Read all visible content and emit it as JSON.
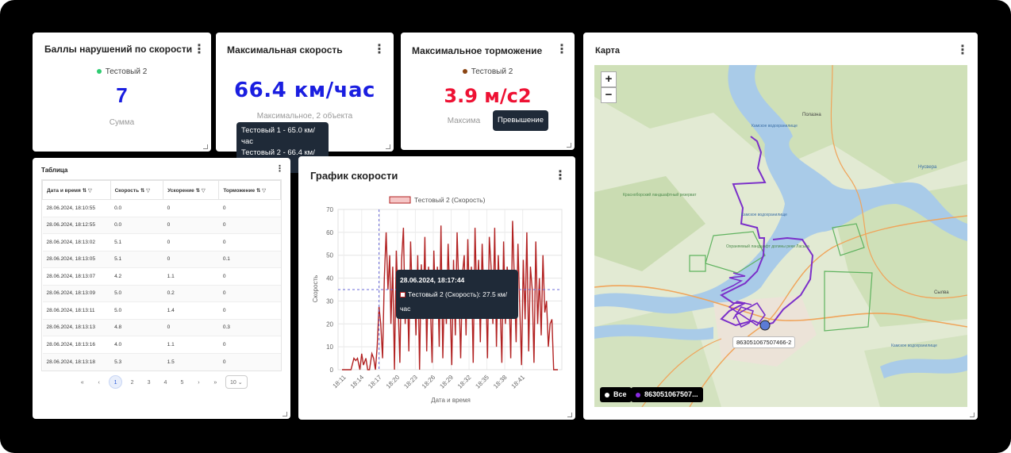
{
  "widget1": {
    "title": "Баллы нарушений по скорости",
    "legend": "Тестовый 2",
    "legend_color": "#2ecc71",
    "value": "7",
    "value_color": "#1a1ee0",
    "sub": "Сумма"
  },
  "widget2": {
    "title": "Максимальная скорость",
    "value": "66.4 км/час",
    "value_color": "#1a1ee0",
    "sub": "Максимальное, 2 объекта",
    "tooltip": [
      "Тестовый 1 - 65.0 км/час",
      "Тестовый 2 - 66.4 км/час"
    ]
  },
  "widget3": {
    "title": "Максимальное торможение",
    "legend": "Тестовый 2",
    "legend_color": "#8b4513",
    "value": "3.9 м/с2",
    "value_color": "#ee1133",
    "sub": "Максима",
    "tooltip": "Превышение"
  },
  "table": {
    "title": "Таблица",
    "columns": [
      "Дата и время",
      "Скорость",
      "Ускорение",
      "Торможение"
    ],
    "rows": [
      [
        "28.06.2024, 18:10:55",
        "0.0",
        "0",
        "0"
      ],
      [
        "28.06.2024, 18:12:55",
        "0.0",
        "0",
        "0"
      ],
      [
        "28.06.2024, 18:13:02",
        "5.1",
        "0",
        "0"
      ],
      [
        "28.06.2024, 18:13:05",
        "5.1",
        "0",
        "0.1"
      ],
      [
        "28.06.2024, 18:13:07",
        "4.2",
        "1.1",
        "0"
      ],
      [
        "28.06.2024, 18:13:09",
        "5.0",
        "0.2",
        "0"
      ],
      [
        "28.06.2024, 18:13:11",
        "5.0",
        "1.4",
        "0"
      ],
      [
        "28.06.2024, 18:13:13",
        "4.8",
        "0",
        "0.3"
      ],
      [
        "28.06.2024, 18:13:16",
        "4.0",
        "1.1",
        "0"
      ],
      [
        "28.06.2024, 18:13:18",
        "5.3",
        "1.5",
        "0"
      ]
    ],
    "pager": {
      "first": "«",
      "prev": "‹",
      "pages": [
        "1",
        "2",
        "3",
        "4",
        "5"
      ],
      "current": "1",
      "next": "›",
      "last": "»",
      "page_size": "10"
    }
  },
  "chart": {
    "title": "График скорости",
    "tooltip_title": "28.06.2024, 18:17:44",
    "tooltip_body": "Тестовый 2 (Скорость): 27.5 км/час",
    "series_color": "#b22222"
  },
  "chart_data": {
    "type": "line",
    "xlabel": "Дата и время",
    "ylabel": "Скорость",
    "ylim": [
      0,
      70
    ],
    "yticks": [
      0,
      10,
      20,
      30,
      40,
      50,
      60,
      70
    ],
    "xticks": [
      "18:11",
      "18:14",
      "18:17",
      "18:20",
      "18:23",
      "18:26",
      "18:29",
      "18:32",
      "18:35",
      "18:38",
      "18:41"
    ],
    "grid": true,
    "legend": "top-center",
    "series": [
      {
        "name": "Тестовый 2 (Скорость)",
        "x": [
          0,
          1.5,
          2,
          2.3,
          2.6,
          3,
          3.3,
          3.6,
          4,
          4.3,
          4.6,
          5,
          5.3,
          5.6,
          5.9,
          6.2,
          6.5,
          6.8,
          7.1,
          7.4,
          7.7,
          8,
          8.2,
          8.5,
          8.8,
          9.1,
          9.4,
          9.7,
          10,
          10.3,
          10.6,
          10.9,
          11.2,
          11.5,
          11.8,
          12.1,
          12.4,
          12.7,
          13,
          13.3,
          13.6,
          13.9,
          14.2,
          14.5,
          14.8,
          15.1,
          15.4,
          15.7,
          16,
          16.3,
          16.6,
          16.9,
          17.2,
          17.5,
          17.8,
          18.1,
          18.4,
          18.7,
          19,
          19.3,
          19.6,
          19.9,
          20.2,
          20.5,
          20.8,
          21.1,
          21.4,
          21.7,
          22,
          22.3,
          22.6,
          22.9,
          23.2,
          23.5,
          23.8,
          24.1,
          24.4,
          24.7,
          25,
          25.3,
          25.6,
          25.9,
          26.2,
          26.5,
          26.8,
          27.1,
          27.4,
          27.7,
          28,
          28.3,
          28.6,
          28.9,
          29.2,
          29.5,
          29.8,
          30.1,
          30.4,
          30.7,
          31,
          31.3,
          31.6,
          31.9,
          32.2,
          32.5,
          32.8,
          33.1,
          33.4,
          33.7,
          34,
          34.3,
          34.6,
          34.9,
          35.2,
          35.5,
          35.8,
          36.2
        ],
        "y": [
          0,
          0,
          5,
          4,
          5,
          0,
          7,
          2,
          5,
          0,
          0,
          7,
          5,
          0,
          10,
          27.5,
          20,
          5,
          40,
          60,
          35,
          50,
          20,
          45,
          0,
          52,
          30,
          3,
          48,
          62,
          20,
          42,
          8,
          56,
          30,
          40,
          15,
          50,
          0,
          46,
          22,
          58,
          8,
          45,
          30,
          3,
          52,
          25,
          45,
          10,
          63,
          5,
          38,
          20,
          55,
          30,
          2,
          48,
          15,
          60,
          35,
          5,
          42,
          50,
          15,
          57,
          25,
          45,
          3,
          62,
          30,
          48,
          12,
          55,
          30,
          40,
          5,
          58,
          45,
          20,
          62,
          10,
          50,
          30,
          3,
          56,
          20,
          45,
          35,
          5,
          65,
          40,
          12,
          55,
          28,
          2,
          48,
          22,
          60,
          8,
          45,
          35,
          3,
          56,
          20,
          40,
          15,
          50,
          25,
          30,
          10,
          20,
          22,
          0,
          0,
          0
        ]
      }
    ]
  },
  "map": {
    "title": "Карта",
    "zoom_in": "+",
    "zoom_out": "−",
    "device_label": "863051067507466-2",
    "legend_all": "Все",
    "legend_device": "863051067507...",
    "legend_device_color": "#8a2be2",
    "labels": [
      "Полазна",
      "Камское водохранилище",
      "Нусвера",
      "Красноборский ландшафтный резерват",
      "Камское водохранилище",
      "Охраняемый ландшафт долины реки Ласьва",
      "Сылва",
      "Камское водохранилище"
    ],
    "route_color": "#7b2fc9"
  }
}
